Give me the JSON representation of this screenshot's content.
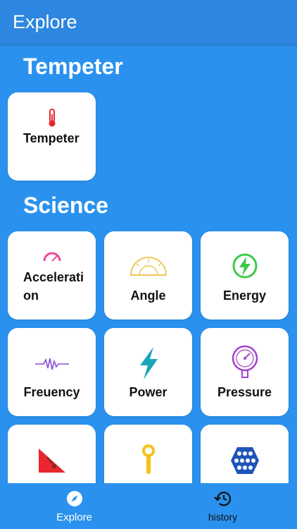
{
  "appbar": {
    "title": "Explore"
  },
  "sections": [
    {
      "title": "Tempeter",
      "cards": [
        {
          "label": "Tempeter",
          "icon": "thermometer-icon"
        }
      ]
    },
    {
      "title": "Science",
      "cards": [
        {
          "label": "Acceleration",
          "icon": "speedometer-icon"
        },
        {
          "label": "Angle",
          "icon": "protractor-icon"
        },
        {
          "label": "Energy",
          "icon": "energy-bolt-icon"
        },
        {
          "label": "Freuency",
          "icon": "waveform-icon"
        },
        {
          "label": "Power",
          "icon": "lightning-icon"
        },
        {
          "label": "Pressure",
          "icon": "pressure-gauge-icon"
        },
        {
          "label": "",
          "icon": "incline-plane-icon"
        },
        {
          "label": "",
          "icon": "key-tool-icon"
        },
        {
          "label": "",
          "icon": "hexagon-grid-icon"
        }
      ]
    }
  ],
  "bottom_nav": [
    {
      "label": "Explore",
      "icon": "compass-icon",
      "active": true
    },
    {
      "label": "history",
      "icon": "history-icon",
      "active": false
    }
  ],
  "colors": {
    "background": "#2a92ee",
    "appbar": "#2d86df",
    "card": "#ffffff"
  }
}
